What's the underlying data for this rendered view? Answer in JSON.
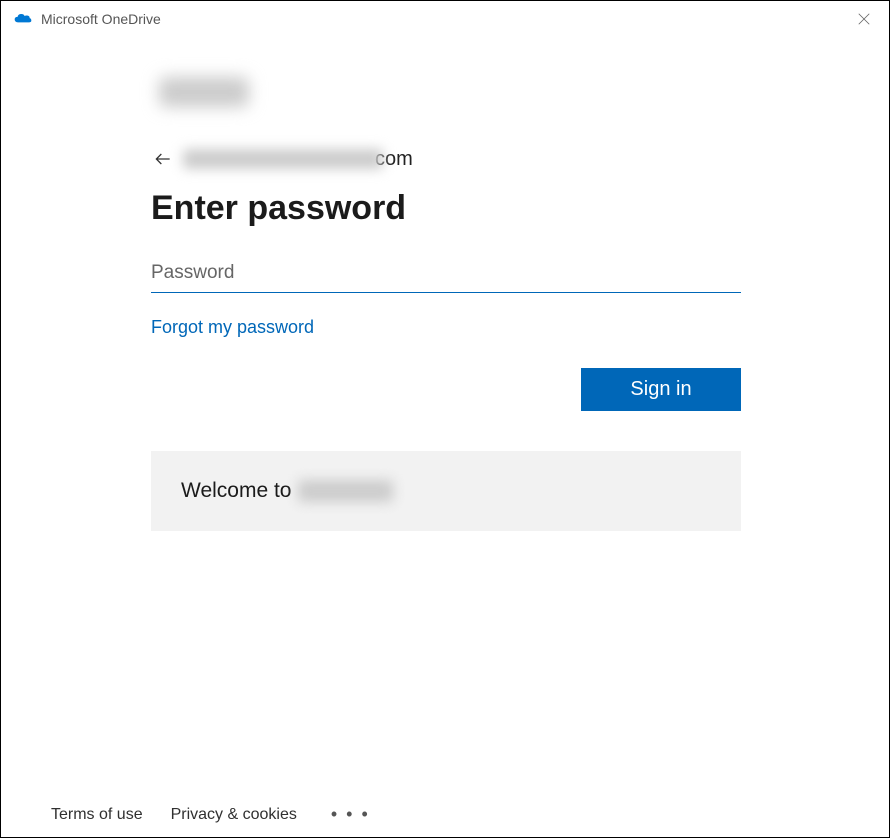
{
  "titlebar": {
    "title": "Microsoft OneDrive"
  },
  "auth": {
    "email_visible_suffix": "com",
    "heading": "Enter password",
    "password_placeholder": "Password",
    "password_value": "",
    "forgot_link": "Forgot my password",
    "signin_label": "Sign in",
    "welcome_prefix": "Welcome to "
  },
  "footer": {
    "terms": "Terms of use",
    "privacy": "Privacy & cookies",
    "more": "• • •"
  },
  "colors": {
    "accent": "#0067b8"
  }
}
